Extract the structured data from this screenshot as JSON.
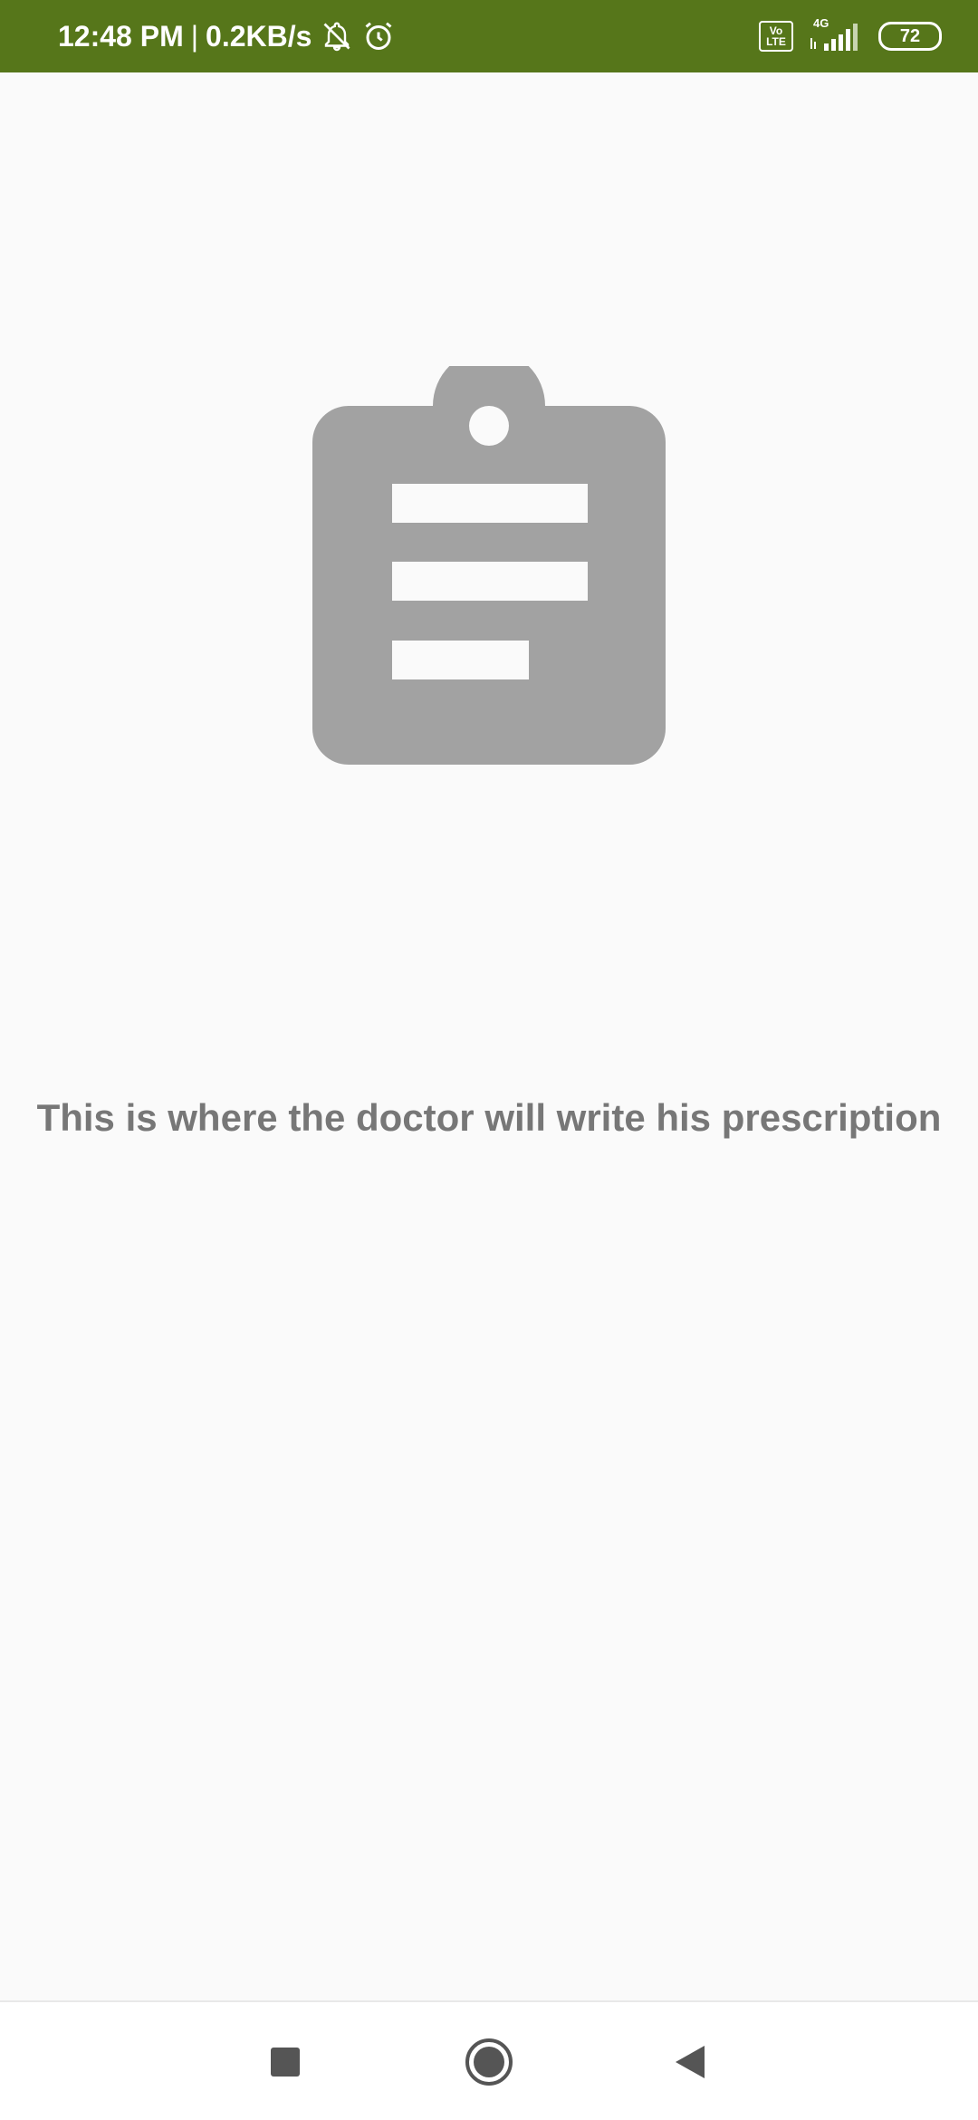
{
  "status_bar": {
    "time": "12:48 PM",
    "separator": "|",
    "network_speed": "0.2KB/s",
    "volte_top": "Vo",
    "volte_bottom": "LTE",
    "network_type": "4G",
    "battery_level": "72",
    "background_color": "#56761a",
    "icons": [
      "notifications-muted-icon",
      "alarm-icon",
      "volte-icon",
      "signal-icon",
      "battery-icon"
    ]
  },
  "main": {
    "empty_state_icon": "clipboard-icon",
    "icon_color": "#a2a2a2",
    "message": "This is where the doctor will write his prescription",
    "message_color": "#777777"
  },
  "nav_bar": {
    "buttons": [
      "recents-button",
      "home-button",
      "back-button"
    ],
    "icon_color": "#555555"
  }
}
